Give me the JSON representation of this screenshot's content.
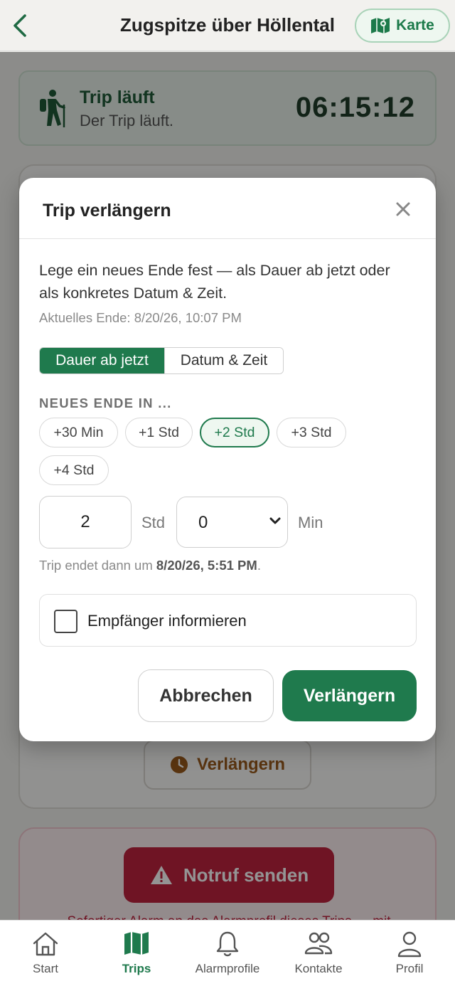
{
  "header": {
    "title": "Zugspitze über Höllental",
    "map_label": "Karte"
  },
  "trip_status": {
    "title": "Trip läuft",
    "subtitle": "Der Trip läuft.",
    "timer": "06:15:12"
  },
  "background": {
    "extend_label": "Verlängern",
    "sos_label": "Notruf senden",
    "sos_note": "Sofortiger Alarm an das Alarmprofil dieses Trips — mit"
  },
  "modal": {
    "title": "Trip verlängern",
    "description": "Lege ein neues Ende fest — als Dauer ab jetzt oder als konkretes Datum & Zeit.",
    "current_end": "Aktuelles Ende: 8/20/26, 10:07 PM",
    "tabs": [
      {
        "label": "Dauer ab jetzt",
        "active": true
      },
      {
        "label": "Datum & Zeit",
        "active": false
      }
    ],
    "section_label": "NEUES ENDE IN ...",
    "chips": [
      {
        "label": "+30 Min",
        "active": false
      },
      {
        "label": "+1 Std",
        "active": false
      },
      {
        "label": "+2 Std",
        "active": true
      },
      {
        "label": "+3 Std",
        "active": false
      },
      {
        "label": "+4 Std",
        "active": false
      }
    ],
    "hours_value": "2",
    "hours_unit": "Std",
    "minutes_value": "0",
    "minutes_unit": "Min",
    "end_prefix": "Trip endet dann um",
    "end_value": "8/20/26, 5:51 PM",
    "end_suffix": ".",
    "notify_label": "Empfänger informieren",
    "notify_checked": false,
    "cancel_label": "Abbrechen",
    "confirm_label": "Verlängern"
  },
  "tabbar": {
    "items": [
      {
        "label": "Start",
        "icon": "home-icon",
        "active": false
      },
      {
        "label": "Trips",
        "icon": "map-icon",
        "active": true
      },
      {
        "label": "Alarmprofile",
        "icon": "bell-icon",
        "active": false
      },
      {
        "label": "Kontakte",
        "icon": "contacts-icon",
        "active": false
      },
      {
        "label": "Profil",
        "icon": "person-icon",
        "active": false
      }
    ]
  },
  "colors": {
    "accent": "#1f7a4d",
    "danger": "#c0233f",
    "warning": "#9a5a1c"
  }
}
